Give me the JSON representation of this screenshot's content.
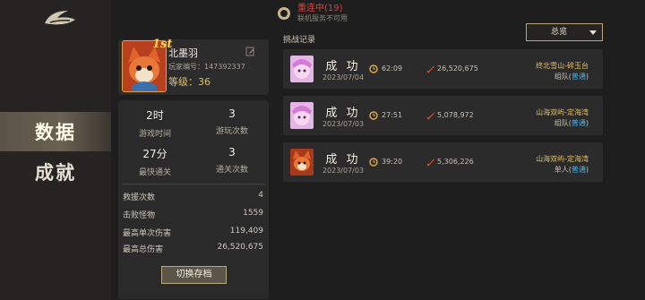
{
  "sidebar": {
    "tabs": [
      {
        "label": "数据",
        "active": true
      },
      {
        "label": "成就",
        "active": false
      }
    ]
  },
  "connection": {
    "status": "重连中(19)",
    "subtitle": "联机服务不可用"
  },
  "profile": {
    "rank_badge": "1st",
    "name": "北墨羽",
    "player_id_label": "玩家编号：147392337",
    "level_label": "等级：",
    "level": "36"
  },
  "stats": {
    "grid": [
      {
        "value": "2时",
        "label": "游戏时间"
      },
      {
        "value": "3",
        "label": "游玩次数"
      },
      {
        "value": "27分",
        "label": "最快通关"
      },
      {
        "value": "3",
        "label": "通关次数"
      }
    ],
    "rows": [
      {
        "label": "救援次数",
        "value": "4"
      },
      {
        "label": "击败怪物",
        "value": "1559"
      },
      {
        "label": "最高单次伤害",
        "value": "119,409"
      },
      {
        "label": "最高总伤害",
        "value": "26,520,675"
      }
    ],
    "switch_label": "切换存档"
  },
  "records": {
    "title": "挑战记录",
    "filter_value": "总览",
    "items": [
      {
        "result": "成 功",
        "date": "2023/07/04",
        "time": "62:09",
        "damage": "26,520,675",
        "location": "终北雪山-碎玉台",
        "mode": "组队",
        "difficulty": "普通",
        "avatar": "pink"
      },
      {
        "result": "成 功",
        "date": "2023/07/03",
        "time": "27:51",
        "damage": "5,078,972",
        "location": "山海双屿-定海湾",
        "mode": "组队",
        "difficulty": "普通",
        "avatar": "pink"
      },
      {
        "result": "成 功",
        "date": "2023/07/03",
        "time": "39:20",
        "damage": "5,306,226",
        "location": "山海双屿-定海湾",
        "mode": "单人",
        "difficulty": "普通",
        "avatar": "fox"
      }
    ]
  },
  "colors": {
    "accent_gold": "#e3c16b",
    "status_red": "#e0403c",
    "difficulty_blue": "#4fb0e6"
  },
  "icons": [
    "game-logo-icon",
    "connection-ring-icon",
    "edit-icon",
    "clock-icon",
    "sword-damage-icon",
    "dropdown-caret-icon"
  ]
}
